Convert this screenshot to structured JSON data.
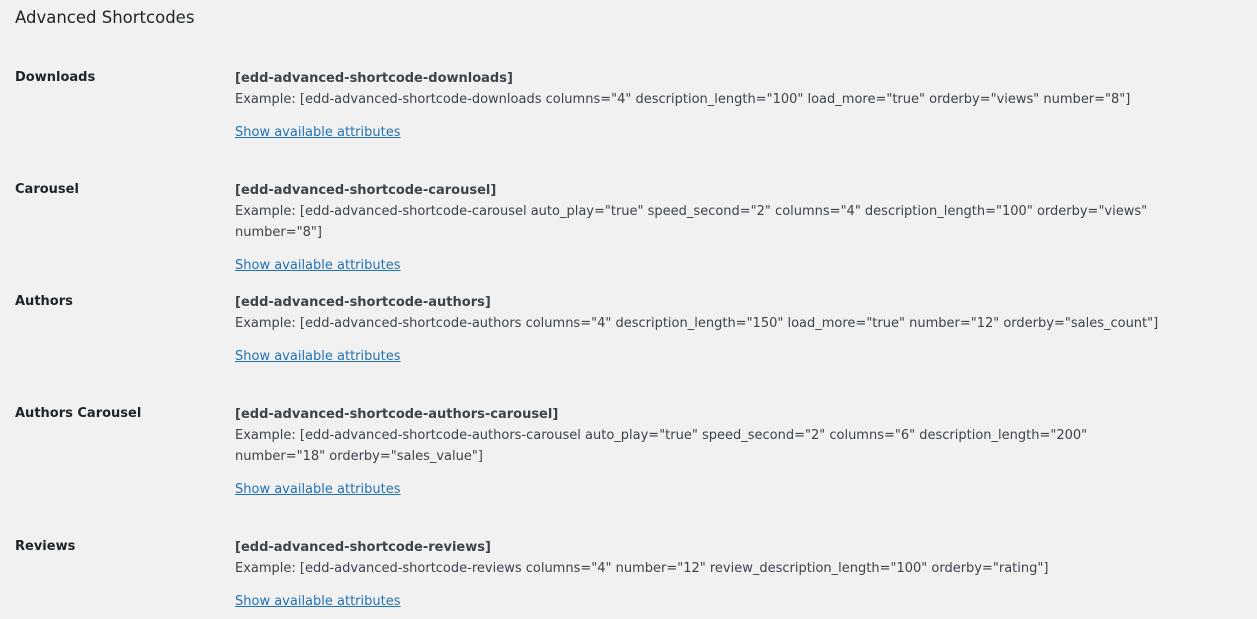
{
  "page": {
    "title": "Advanced Shortcodes"
  },
  "rows": [
    {
      "label": "Downloads",
      "shortcode": "[edd-advanced-shortcode-downloads]",
      "example": "Example: [edd-advanced-shortcode-downloads columns=\"4\" description_length=\"100\" load_more=\"true\" orderby=\"views\" number=\"8\"]",
      "link": "Show available attributes"
    },
    {
      "label": "Carousel",
      "shortcode": "[edd-advanced-shortcode-carousel]",
      "example": "Example: [edd-advanced-shortcode-carousel auto_play=\"true\" speed_second=\"2\" columns=\"4\" description_length=\"100\" orderby=\"views\" number=\"8\"]",
      "link": "Show available attributes"
    },
    {
      "label": "Authors",
      "shortcode": "[edd-advanced-shortcode-authors]",
      "example": "Example: [edd-advanced-shortcode-authors columns=\"4\" description_length=\"150\" load_more=\"true\" number=\"12\" orderby=\"sales_count\"]",
      "link": "Show available attributes"
    },
    {
      "label": "Authors Carousel",
      "shortcode": "[edd-advanced-shortcode-authors-carousel]",
      "example": "Example: [edd-advanced-shortcode-authors-carousel auto_play=\"true\" speed_second=\"2\" columns=\"6\" description_length=\"200\" number=\"18\" orderby=\"sales_value\"]",
      "link": "Show available attributes"
    },
    {
      "label": "Reviews",
      "shortcode": "[edd-advanced-shortcode-reviews]",
      "example": "Example: [edd-advanced-shortcode-reviews columns=\"4\" number=\"12\" review_description_length=\"100\" orderby=\"rating\"]",
      "link": "Show available attributes"
    }
  ]
}
